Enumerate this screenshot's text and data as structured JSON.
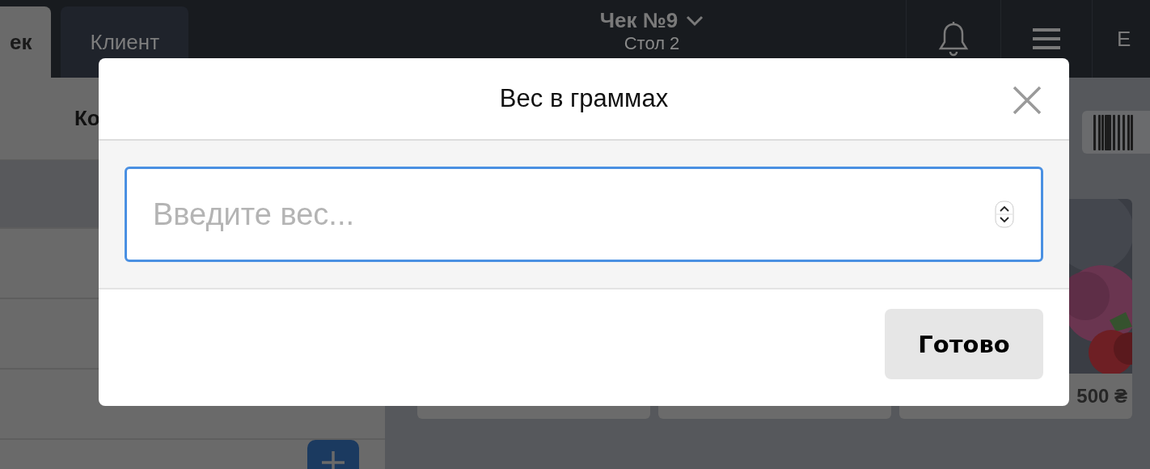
{
  "top_bar": {
    "tabs": [
      {
        "label": "ек",
        "selected": true
      },
      {
        "label": "Клиент",
        "selected": false
      }
    ],
    "receipt": {
      "title": "Чек №9",
      "subtitle": "Стол 2"
    },
    "user": "Е"
  },
  "order_panel": {
    "heading": "Ко",
    "rows": [
      {
        "selected": true
      },
      {
        "selected": false
      },
      {
        "selected": false
      },
      {
        "selected": false
      }
    ]
  },
  "catalog": {
    "price": "500 ₴"
  },
  "dialog": {
    "title": "Вес в граммах",
    "placeholder": "Введите вес...",
    "button": "Готово"
  }
}
